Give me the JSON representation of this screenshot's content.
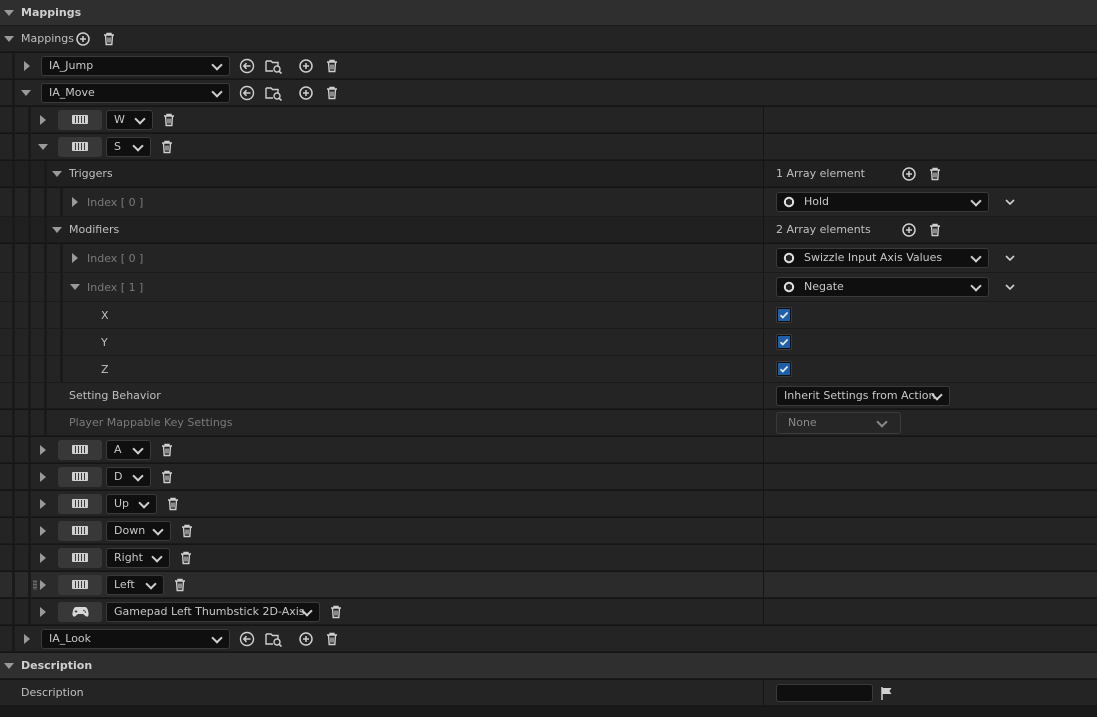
{
  "mappings_section": {
    "title": "Mappings"
  },
  "mappings_array": {
    "label": "Mappings"
  },
  "actions": [
    {
      "name": "IA_Jump"
    },
    {
      "name": "IA_Move"
    },
    {
      "name": "IA_Look"
    }
  ],
  "move_keys_top": [
    {
      "key": "W"
    },
    {
      "key": "S"
    }
  ],
  "triggers": {
    "label": "Triggers",
    "count": "1 Array element",
    "items": [
      {
        "index": "Index [ 0 ]",
        "value": "Hold"
      }
    ]
  },
  "modifiers": {
    "label": "Modifiers",
    "count": "2 Array elements",
    "items": [
      {
        "index": "Index [ 0 ]",
        "value": "Swizzle Input Axis Values"
      },
      {
        "index": "Index [ 1 ]",
        "value": "Negate"
      }
    ]
  },
  "negate_axes": [
    {
      "label": "X",
      "checked": true
    },
    {
      "label": "Y",
      "checked": true
    },
    {
      "label": "Z",
      "checked": true
    }
  ],
  "setting_behavior": {
    "label": "Setting Behavior",
    "value": "Inherit Settings from Action"
  },
  "player_mappable": {
    "label": "Player Mappable Key Settings",
    "value": "None"
  },
  "move_keys_bottom": [
    {
      "key": "A",
      "device": "keyboard-icon"
    },
    {
      "key": "D",
      "device": "keyboard-icon"
    },
    {
      "key": "Up",
      "device": "keyboard-icon"
    },
    {
      "key": "Down",
      "device": "keyboard-icon"
    },
    {
      "key": "Right",
      "device": "keyboard-icon"
    },
    {
      "key": "Left",
      "device": "keyboard-icon"
    },
    {
      "key": "Gamepad Left Thumbstick 2D-Axis",
      "device": "gamepad-icon"
    }
  ],
  "description_section": {
    "title": "Description"
  },
  "description_field": {
    "label": "Description",
    "value": ""
  }
}
